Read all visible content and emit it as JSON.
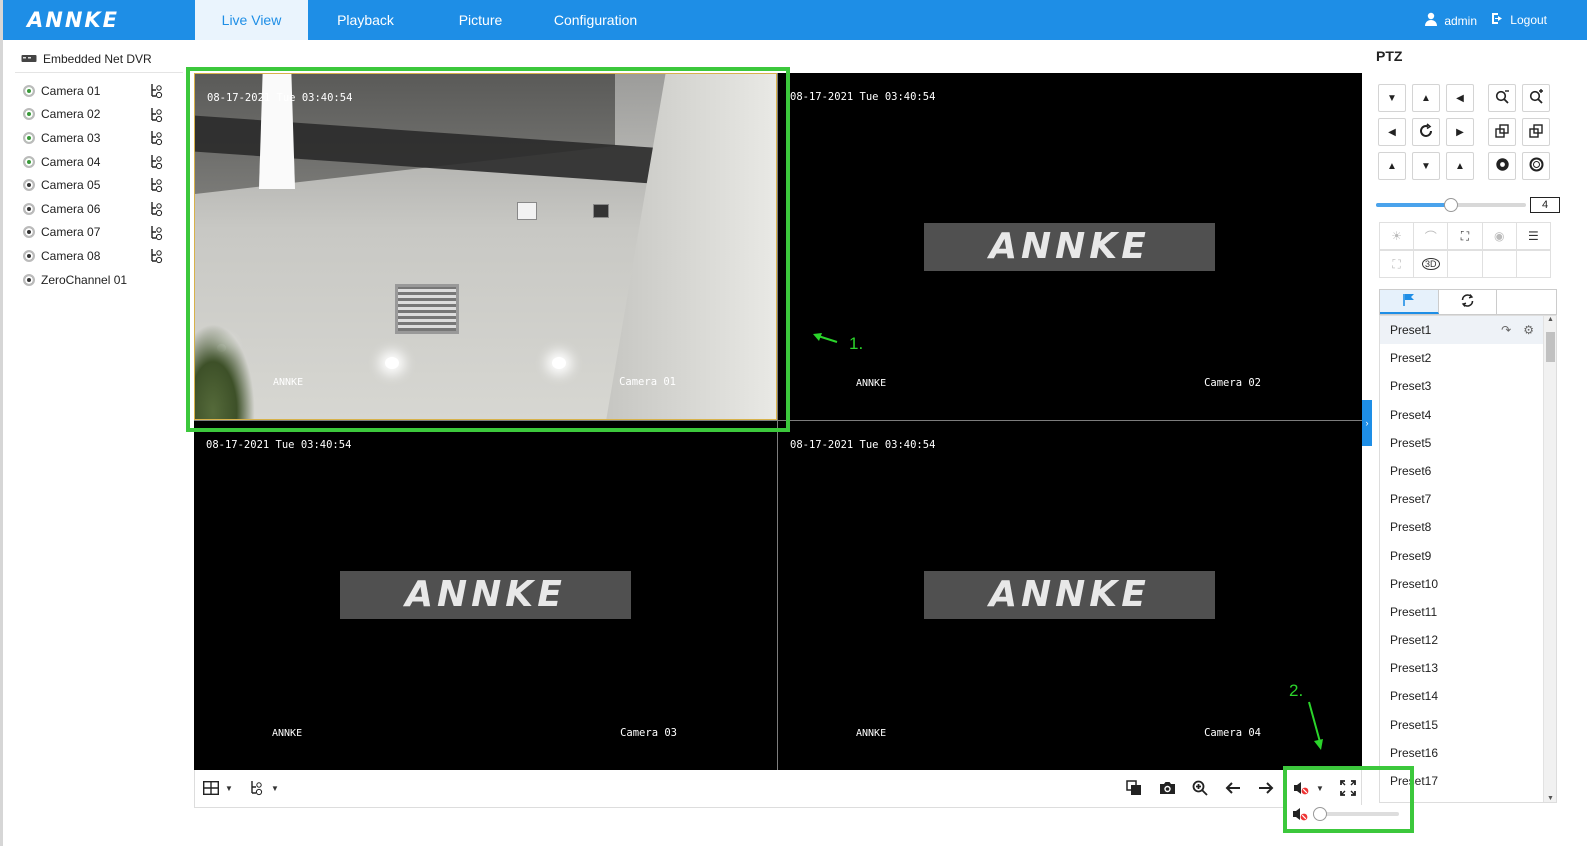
{
  "header": {
    "logo": "ANNKE",
    "tabs": [
      {
        "label": "Live View",
        "active": true
      },
      {
        "label": "Playback",
        "active": false
      },
      {
        "label": "Picture",
        "active": false
      },
      {
        "label": "Configuration",
        "active": false
      }
    ],
    "user": "admin",
    "logout": "Logout"
  },
  "device_tree": {
    "root": "Embedded Net DVR",
    "cameras": [
      {
        "name": "Camera 01",
        "live": true
      },
      {
        "name": "Camera 02",
        "live": true
      },
      {
        "name": "Camera 03",
        "live": true
      },
      {
        "name": "Camera 04",
        "live": true
      },
      {
        "name": "Camera 05",
        "live": false
      },
      {
        "name": "Camera 06",
        "live": false
      },
      {
        "name": "Camera 07",
        "live": false
      },
      {
        "name": "Camera 08",
        "live": false
      },
      {
        "name": "ZeroChannel 01",
        "live": false
      }
    ]
  },
  "video": {
    "tiles": [
      {
        "timestamp": "08-17-2021 Tue 03:40:54",
        "brand": "ANNKE",
        "camera": "Camera 01",
        "placeholder": ""
      },
      {
        "timestamp": "08-17-2021 Tue 03:40:54",
        "brand": "ANNKE",
        "camera": "Camera 02",
        "placeholder": "ANNKE"
      },
      {
        "timestamp": "08-17-2021 Tue 03:40:54",
        "brand": "ANNKE",
        "camera": "Camera 03",
        "placeholder": "ANNKE"
      },
      {
        "timestamp": "08-17-2021 Tue 03:40:54",
        "brand": "ANNKE",
        "camera": "Camera 04",
        "placeholder": "ANNKE"
      }
    ]
  },
  "ptz": {
    "title": "PTZ",
    "speed": 4,
    "speed_fraction": 0.5,
    "presets": [
      "Preset1",
      "Preset2",
      "Preset3",
      "Preset4",
      "Preset5",
      "Preset6",
      "Preset7",
      "Preset8",
      "Preset9",
      "Preset10",
      "Preset11",
      "Preset12",
      "Preset13",
      "Preset14",
      "Preset15",
      "Preset16",
      "Preset17"
    ]
  },
  "annotations": {
    "label1": "1.",
    "label2": "2."
  },
  "colors": {
    "accent": "#1e8ee6",
    "annotation": "#3cc83c",
    "selected_border": "#d8b24a"
  }
}
